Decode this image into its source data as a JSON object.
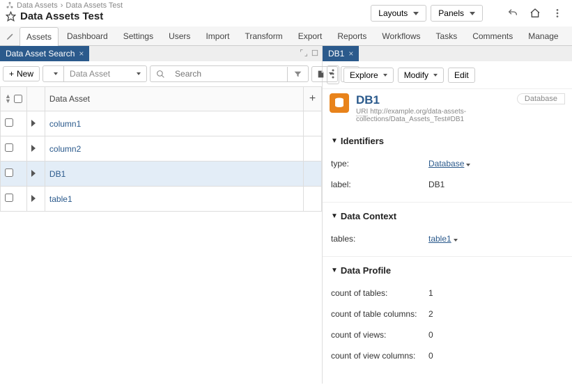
{
  "breadcrumb": {
    "root": "Data Assets",
    "current": "Data Assets Test"
  },
  "page_title": "Data Assets Test",
  "header_buttons": {
    "layouts": "Layouts",
    "panels": "Panels"
  },
  "menu": [
    "Assets",
    "Dashboard",
    "Settings",
    "Users",
    "Import",
    "Transform",
    "Export",
    "Reports",
    "Workflows",
    "Tasks",
    "Comments",
    "Manage"
  ],
  "menu_active_index": 0,
  "left": {
    "tab_label": "Data Asset Search",
    "new_btn": "New",
    "asset_type_select": "Data Asset",
    "search_placeholder": "Search",
    "column_header": "Data Asset",
    "rows": [
      {
        "label": "column1",
        "selected": false
      },
      {
        "label": "column2",
        "selected": false
      },
      {
        "label": "DB1",
        "selected": true
      },
      {
        "label": "table1",
        "selected": false
      }
    ]
  },
  "right": {
    "tab_label": "DB1",
    "toolbar": {
      "explore": "Explore",
      "modify": "Modify",
      "edit": "Edit"
    },
    "title": "DB1",
    "type_pill": "Database",
    "uri_label": "URI",
    "uri": "http://example.org/data-assets-collections/Data_Assets_Test#DB1",
    "sections": {
      "identifiers": {
        "title": "Identifiers",
        "rows": [
          {
            "k": "type:",
            "v": "Database",
            "link": true,
            "caret": true
          },
          {
            "k": "label:",
            "v": "DB1",
            "link": false,
            "caret": false
          }
        ]
      },
      "data_context": {
        "title": "Data Context",
        "rows": [
          {
            "k": "tables:",
            "v": "table1",
            "link": true,
            "caret": true
          }
        ]
      },
      "data_profile": {
        "title": "Data Profile",
        "rows": [
          {
            "k": "count of tables:",
            "v": "1"
          },
          {
            "k": "count of table columns:",
            "v": "2"
          },
          {
            "k": "count of views:",
            "v": "0"
          },
          {
            "k": "count of view columns:",
            "v": "0"
          }
        ]
      }
    }
  }
}
